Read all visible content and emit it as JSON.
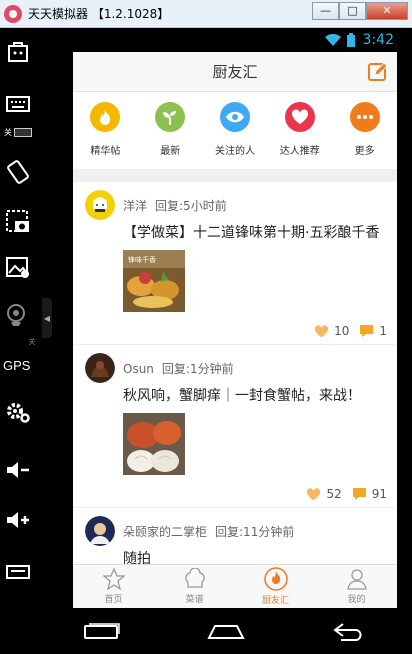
{
  "window": {
    "title": "天天模拟器 【1.2.1028】",
    "buttons": {
      "minimize": "—",
      "maximize": "□",
      "close": "✕"
    }
  },
  "toolbar": {
    "switch_label": "关",
    "gps_label": "GPS",
    "items": [
      "bag-icon",
      "keyboard-icon",
      "rotate-icon",
      "screenshot-icon",
      "gallery-icon",
      "webcam-icon",
      "settings-icon",
      "volume-down-icon",
      "volume-up-icon",
      "menu-icon"
    ],
    "webcam_label": "关"
  },
  "statusbar": {
    "time": "3:42"
  },
  "app": {
    "title": "厨友汇",
    "categories": [
      {
        "label": "精华帖",
        "color": "#f5b800",
        "icon": "flame-icon"
      },
      {
        "label": "最新",
        "color": "#8cc152",
        "icon": "sprout-icon"
      },
      {
        "label": "关注的人",
        "color": "#3fa9f5",
        "icon": "eye-icon"
      },
      {
        "label": "达人推荐",
        "color": "#e9364d",
        "icon": "heart-icon"
      },
      {
        "label": "更多",
        "color": "#f07b1c",
        "icon": "more-icon"
      }
    ],
    "posts": [
      {
        "user": "洋洋",
        "reply": "回复:5小时前",
        "title": "【学做菜】十二道锋味第十期·五彩酿千香",
        "thumb_text": "锋味千香",
        "likes": "10",
        "comments": "1"
      },
      {
        "user": "Osun",
        "reply": "回复:1分钟前",
        "title": "秋风响，蟹脚痒｜一封食蟹帖，来战！",
        "likes": "52",
        "comments": "91"
      },
      {
        "user": "朵颐家的二掌柜",
        "reply": "回复:11分钟前",
        "title": "随拍"
      }
    ],
    "tabs": [
      {
        "label": "首页",
        "icon": "star-icon"
      },
      {
        "label": "菜谱",
        "icon": "chef-hat-icon"
      },
      {
        "label": "厨友汇",
        "icon": "flame-icon"
      },
      {
        "label": "我的",
        "icon": "person-icon"
      }
    ],
    "accent": "#f07b1c",
    "like_color": "#f5b860",
    "comment_color": "#f5a623"
  }
}
